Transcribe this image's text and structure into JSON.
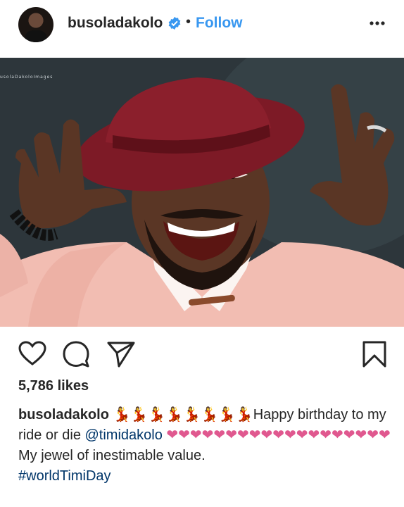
{
  "header": {
    "username": "busoladakolo",
    "separator": "•",
    "follow_label": "Follow"
  },
  "photo": {
    "watermark": "usolaDakoloImages"
  },
  "post": {
    "likes": "5,786 likes",
    "caption": {
      "username": "busoladakolo",
      "dancers": "💃💃💃💃💃💃💃💃",
      "text_1": "Happy birthday to my ride or die ",
      "mention": "@timidakolo",
      "hearts": " ❤❤❤❤❤❤❤❤❤❤❤❤❤❤❤❤❤❤❤",
      "line_2": "My jewel of inestimable value.",
      "hashtag": "#worldTimiDay"
    }
  },
  "colors": {
    "accent": "#3897f0",
    "link": "#003569",
    "heart": "#e0588f",
    "hat": "#8b1f2c",
    "shirt": "#f2bdb2"
  },
  "icons": [
    "verified-badge-icon",
    "more-options-icon",
    "like-heart-icon",
    "comment-icon",
    "share-icon",
    "bookmark-icon"
  ]
}
